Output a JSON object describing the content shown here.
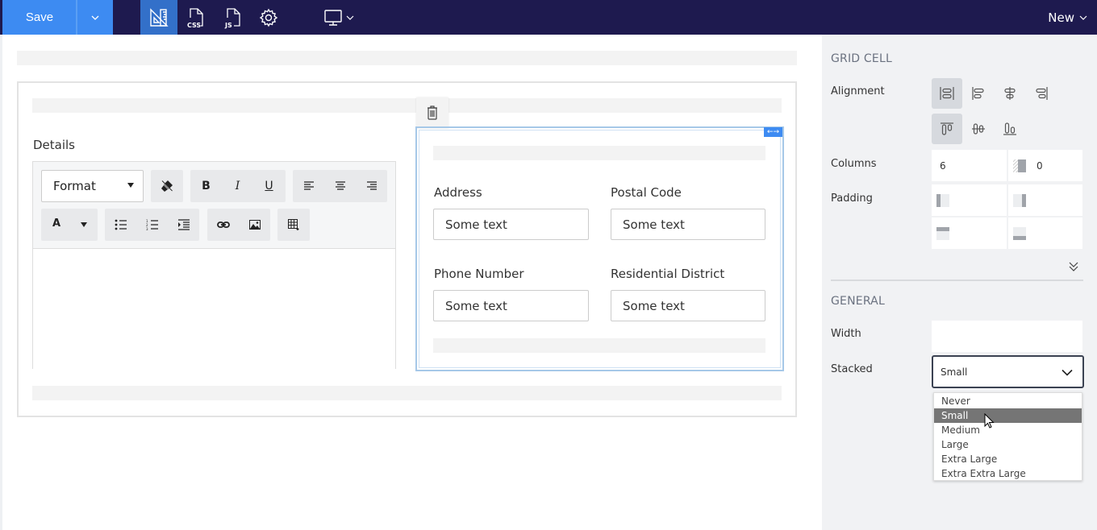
{
  "toolbar": {
    "save_label": "Save",
    "save_dropdown_icon": "chevron-down-icon",
    "icons": [
      {
        "name": "design-mode-icon",
        "active": true
      },
      {
        "name": "css-file-icon",
        "active": false
      },
      {
        "name": "js-file-icon",
        "active": false
      },
      {
        "name": "settings-gear-icon",
        "active": false
      },
      {
        "name": "desktop-preview-icon",
        "active": false
      }
    ],
    "new_label": "New"
  },
  "canvas": {
    "details_label": "Details",
    "editor": {
      "format_label": "Format",
      "buttons": {
        "clear_format": "clear-format-icon",
        "bold": "B",
        "italic": "I",
        "underline": "U",
        "align_left": "align-left-icon",
        "align_center": "align-center-icon",
        "align_right": "align-right-icon",
        "font_color": "A",
        "bullet_list": "bullet-list-icon",
        "numbered_list": "numbered-list-icon",
        "indent": "indent-icon",
        "link": "link-icon",
        "image": "image-icon",
        "table": "table-icon"
      }
    },
    "resize_tag": "←→",
    "fields": [
      {
        "label": "Address",
        "value": "Some text"
      },
      {
        "label": "Postal Code",
        "value": "Some text"
      },
      {
        "label": "Phone Number",
        "value": "Some text"
      },
      {
        "label": "Residential District",
        "value": "Some text"
      }
    ]
  },
  "panel": {
    "grid_cell_title": "GRID CELL",
    "alignment_label": "Alignment",
    "horizontal_alignment": [
      "stretch",
      "left",
      "center",
      "right"
    ],
    "horizontal_selected": "stretch",
    "vertical_alignment": [
      "top",
      "middle",
      "bottom"
    ],
    "vertical_selected": "top",
    "columns_label": "Columns",
    "columns_value": "6",
    "offset_value": "0",
    "padding_label": "Padding",
    "general_title": "GENERAL",
    "width_label": "Width",
    "width_value": "",
    "stacked_label": "Stacked",
    "stacked_value": "Small",
    "stacked_options": [
      "Never",
      "Small",
      "Medium",
      "Large",
      "Extra Large",
      "Extra Extra Large"
    ],
    "stacked_highlighted": "Small"
  },
  "colors": {
    "topbar_bg": "#1e1a4f",
    "save_bg": "#3d8bf2",
    "active_icon_bg": "#3370c9",
    "selection_border": "#a6c8e8",
    "panel_bg": "#f1f2f4"
  }
}
